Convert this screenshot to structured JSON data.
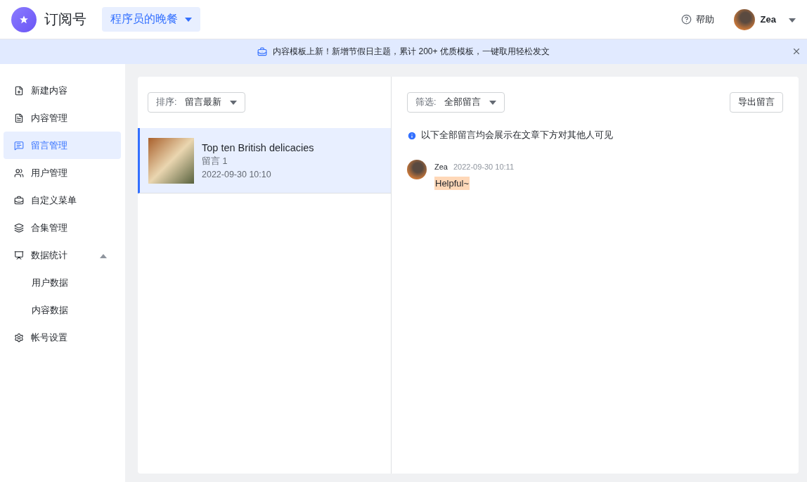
{
  "header": {
    "product": "订阅号",
    "account": "程序员的晚餐",
    "help": "帮助",
    "user": "Zea"
  },
  "banner": {
    "text": "内容模板上新！新增节假日主题，累计 200+ 优质模板，一键取用轻松发文"
  },
  "sidebar": {
    "items": [
      {
        "label": "新建内容",
        "selected": false
      },
      {
        "label": "内容管理",
        "selected": false
      },
      {
        "label": "留言管理",
        "selected": true
      },
      {
        "label": "用户管理",
        "selected": false
      },
      {
        "label": "自定义菜单",
        "selected": false
      },
      {
        "label": "合集管理",
        "selected": false
      },
      {
        "label": "数据统计",
        "selected": false,
        "expanded": true,
        "children": [
          {
            "label": "用户数据",
            "selected": false
          },
          {
            "label": "内容数据",
            "selected": false
          }
        ]
      },
      {
        "label": "帐号设置",
        "selected": false
      }
    ]
  },
  "articles": {
    "sort": {
      "label": "排序:",
      "value": "留言最新"
    },
    "items": [
      {
        "title": "Top ten British delicacies",
        "count": "留言 1",
        "time": "2022-09-30 10:10",
        "selected": true
      }
    ]
  },
  "comments": {
    "filter": {
      "label": "筛选:",
      "value": "全部留言"
    },
    "export": "导出留言",
    "notice": "以下全部留言均会展示在文章下方对其他人可见",
    "items": [
      {
        "author": "Zea",
        "time": "2022-09-30 10:11",
        "text": "Helpful~",
        "highlighted": true
      }
    ]
  }
}
